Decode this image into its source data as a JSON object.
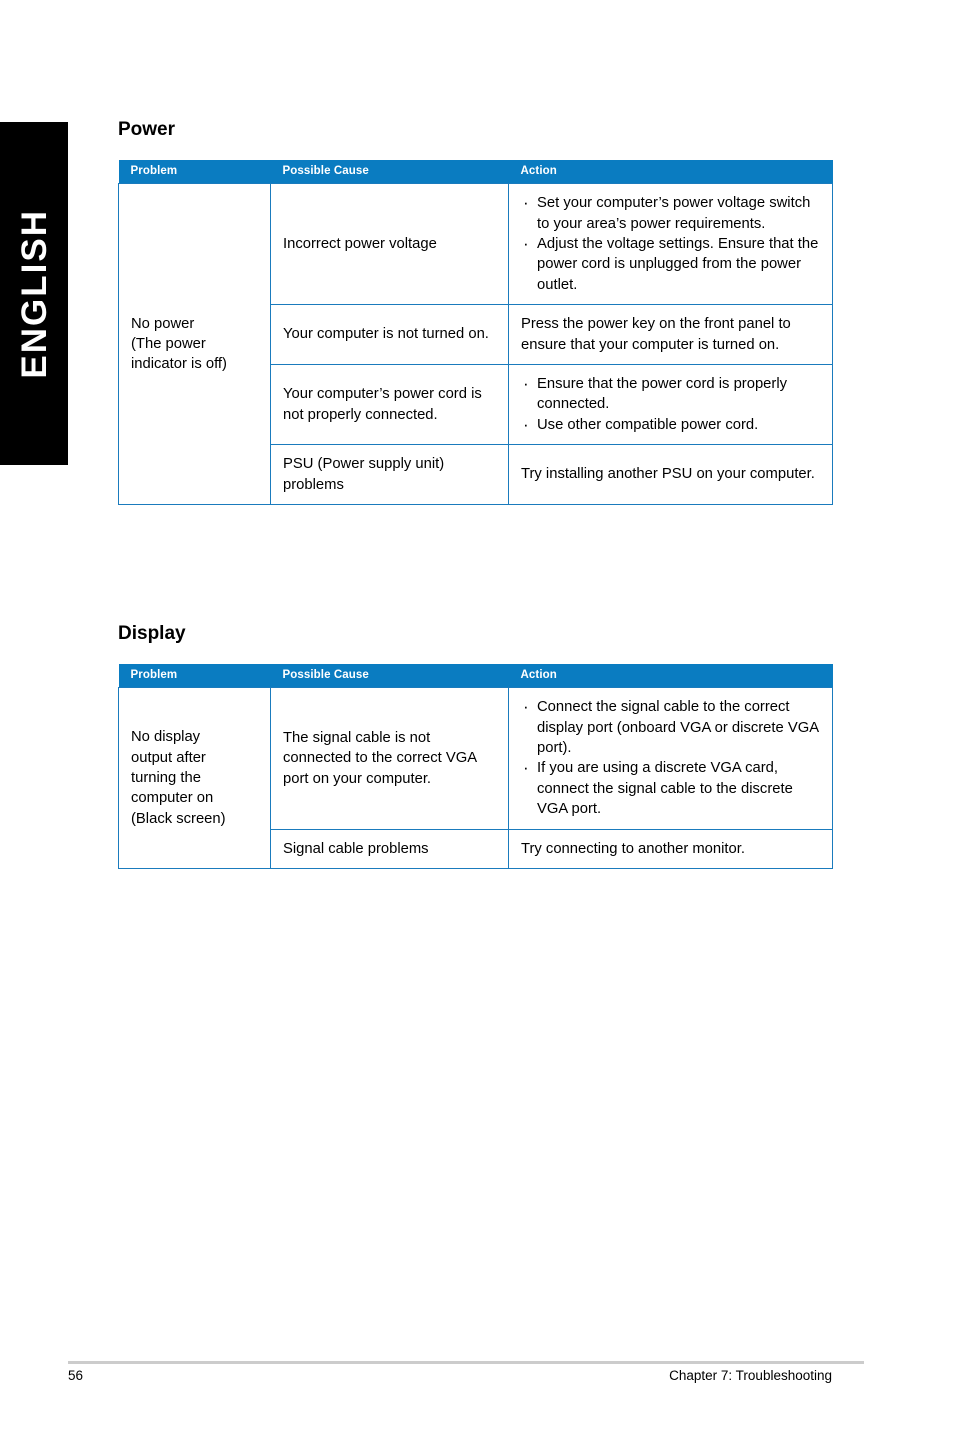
{
  "page": {
    "language_tab": "ENGLISH",
    "footer": {
      "page_number": "56",
      "chapter": "Chapter 7: Troubleshooting"
    },
    "colors": {
      "header_blue": "#0a7cc1",
      "border_blue": "#1a7bbd",
      "tab_black": "#000000",
      "rule_gray": "#cccccc"
    }
  },
  "sections": [
    {
      "heading": "Power",
      "columns": [
        "Problem",
        "Possible Cause",
        "Action"
      ],
      "problem": "No power\n(The power\nindicator is off)",
      "rows": [
        {
          "cause": "Incorrect power voltage",
          "action_type": "bullets",
          "action": [
            "Set your computer’s power voltage switch to your area’s power requirements.",
            "Adjust the voltage settings. Ensure that the power cord is unplugged from the power outlet."
          ]
        },
        {
          "cause": "Your computer is not turned on.",
          "action_type": "plain",
          "action": [
            "Press the power key on the front panel to ensure that your computer is turned on."
          ]
        },
        {
          "cause": "Your computer’s power cord is not properly connected.",
          "action_type": "bullets",
          "action": [
            "Ensure that the power cord is properly connected.",
            "Use other compatible power cord."
          ]
        },
        {
          "cause": "PSU (Power supply unit) problems",
          "action_type": "plain",
          "action": [
            "Try installing another PSU on your computer."
          ]
        }
      ]
    },
    {
      "heading": "Display",
      "columns": [
        "Problem",
        "Possible Cause",
        "Action"
      ],
      "problem": "No display\noutput after\nturning the\ncomputer on\n(Black screen)",
      "rows": [
        {
          "cause": "The signal cable is not connected to the correct VGA port on your computer.",
          "action_type": "bullets",
          "action": [
            "Connect the signal cable to the correct display port (onboard VGA or discrete VGA port).",
            "If you are using a discrete VGA card, connect the signal cable to the discrete VGA port."
          ]
        },
        {
          "cause": "Signal cable problems",
          "action_type": "plain",
          "action": [
            "Try connecting to another monitor."
          ]
        }
      ]
    }
  ]
}
